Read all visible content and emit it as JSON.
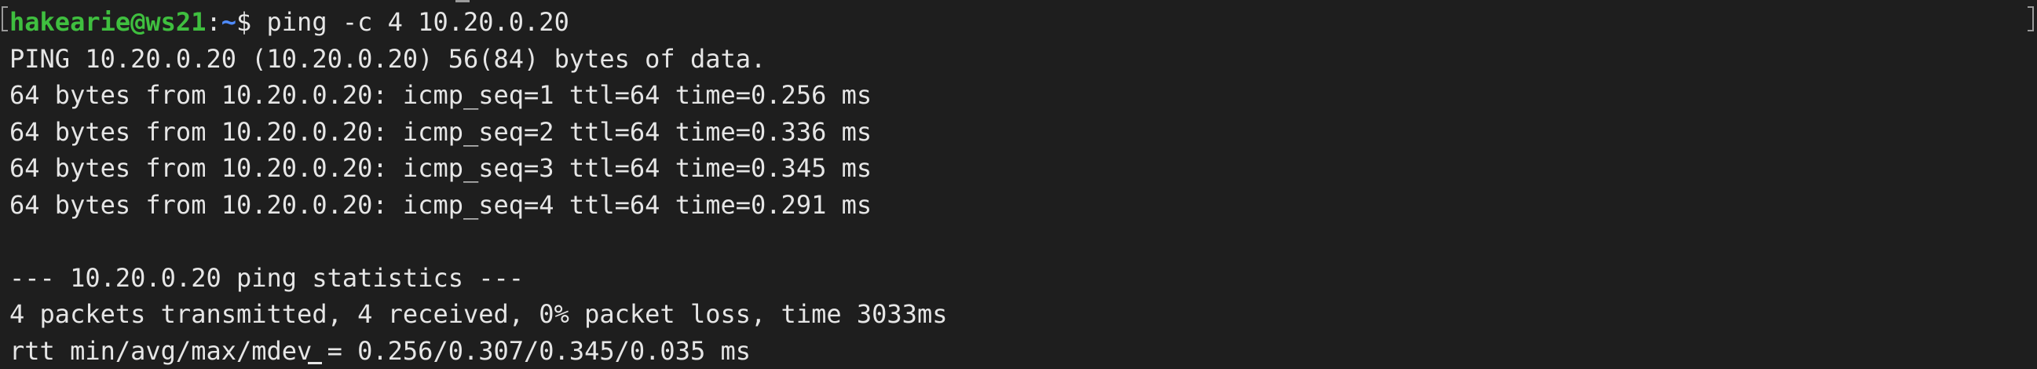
{
  "prompt": {
    "user_host": "hakearie@ws21",
    "separator": ":",
    "path": "~",
    "symbol": "$",
    "command": " ping -c 4 10.20.0.20"
  },
  "output": {
    "header": "PING 10.20.0.20 (10.20.0.20) 56(84) bytes of data.",
    "replies": [
      "64 bytes from 10.20.0.20: icmp_seq=1 ttl=64 time=0.256 ms",
      "64 bytes from 10.20.0.20: icmp_seq=2 ttl=64 time=0.336 ms",
      "64 bytes from 10.20.0.20: icmp_seq=3 ttl=64 time=0.345 ms",
      "64 bytes from 10.20.0.20: icmp_seq=4 ttl=64 time=0.291 ms"
    ],
    "stats_header": "--- 10.20.0.20 ping statistics ---",
    "stats_packets": "4 packets transmitted, 4 received, 0% packet loss, time 3033ms",
    "stats_rtt": "rtt min/avg/max/mdev = 0.256/0.307/0.345/0.035 ms"
  },
  "colors": {
    "background": "#1e1e1e",
    "text": "#e6e6e6",
    "user_host": "#3fbf3f",
    "path": "#4f8cff"
  }
}
